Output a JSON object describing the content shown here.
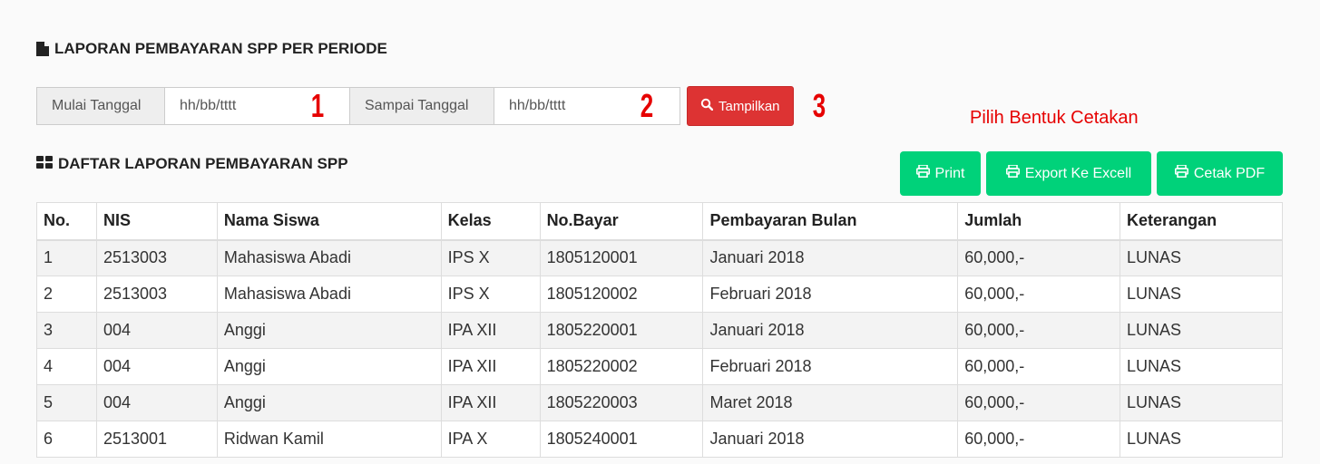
{
  "report": {
    "title": "LAPORAN PEMBAYARAN SPP PER PERIODE"
  },
  "filter": {
    "start_label": "Mulai Tanggal",
    "start_placeholder": "hh/bb/tttt",
    "marker1": "1",
    "end_label": "Sampai Tanggal",
    "end_placeholder": "hh/bb/tttt",
    "marker2": "2",
    "show_button": "Tampilkan",
    "marker3": "3"
  },
  "hint": "Pilih Bentuk Cetakan",
  "list": {
    "title": "DAFTAR LAPORAN PEMBAYARAN SPP",
    "print_button": "Print",
    "excel_button": "Export Ke Excell",
    "pdf_button": "Cetak PDF"
  },
  "colors": {
    "accent_red": "#dd3333",
    "marker_red": "#e60000",
    "action_green": "#00d27a"
  },
  "icons": {
    "title": "file-icon",
    "list": "grid-icon",
    "search": "search-icon",
    "print": "printer-icon"
  },
  "table": {
    "headers": [
      "No.",
      "NIS",
      "Nama Siswa",
      "Kelas",
      "No.Bayar",
      "Pembayaran Bulan",
      "Jumlah",
      "Keterangan"
    ],
    "rows": [
      [
        "1",
        "2513003",
        "Mahasiswa Abadi",
        "IPS X",
        "1805120001",
        "Januari 2018",
        "60,000,-",
        "LUNAS"
      ],
      [
        "2",
        "2513003",
        "Mahasiswa Abadi",
        "IPS X",
        "1805120002",
        "Februari 2018",
        "60,000,-",
        "LUNAS"
      ],
      [
        "3",
        "004",
        "Anggi",
        "IPA XII",
        "1805220001",
        "Januari 2018",
        "60,000,-",
        "LUNAS"
      ],
      [
        "4",
        "004",
        "Anggi",
        "IPA XII",
        "1805220002",
        "Februari 2018",
        "60,000,-",
        "LUNAS"
      ],
      [
        "5",
        "004",
        "Anggi",
        "IPA XII",
        "1805220003",
        "Maret 2018",
        "60,000,-",
        "LUNAS"
      ],
      [
        "6",
        "2513001",
        "Ridwan Kamil",
        "IPA X",
        "1805240001",
        "Januari 2018",
        "60,000,-",
        "LUNAS"
      ]
    ]
  }
}
